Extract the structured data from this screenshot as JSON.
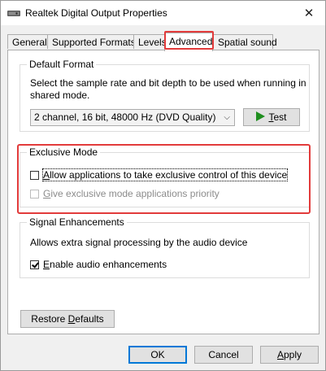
{
  "window": {
    "title": "Realtek Digital Output Properties",
    "icon": "speaker-icon",
    "close_label": "✕"
  },
  "tabs": [
    {
      "label": "General",
      "active": false
    },
    {
      "label": "Supported Formats",
      "active": false
    },
    {
      "label": "Levels",
      "active": false
    },
    {
      "label": "Advanced",
      "active": true
    },
    {
      "label": "Spatial sound",
      "active": false
    }
  ],
  "default_format": {
    "title": "Default Format",
    "description": "Select the sample rate and bit depth to be used when running in shared mode.",
    "selected_value": "2 channel, 16 bit, 48000 Hz (DVD Quality)",
    "test_button": {
      "prefix": "",
      "accel": "T",
      "suffix": "est"
    }
  },
  "exclusive_mode": {
    "title": "Exclusive Mode",
    "allow_label": {
      "accel": "A",
      "rest": "llow applications to take exclusive control of this device"
    },
    "allow_checked": false,
    "priority_label": {
      "accel": "G",
      "rest": "ive exclusive mode applications priority"
    },
    "priority_checked": false,
    "priority_enabled": false
  },
  "signal_enhancements": {
    "title": "Signal Enhancements",
    "description": "Allows extra signal processing by the audio device",
    "enable_label": {
      "accel": "E",
      "rest": "nable audio enhancements"
    },
    "enable_checked": true
  },
  "buttons": {
    "restore": {
      "prefix": "Restore ",
      "accel": "D",
      "suffix": "efaults"
    },
    "ok": "OK",
    "cancel": "Cancel",
    "apply": {
      "accel": "A",
      "suffix": "pply"
    }
  },
  "colors": {
    "highlight": "#e23b3b",
    "accent": "#0078d7",
    "test_icon": "#1e8e1e"
  }
}
